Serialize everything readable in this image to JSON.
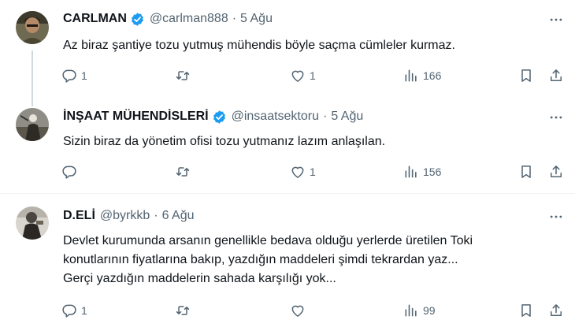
{
  "tweets": [
    {
      "name": "CARLMAN",
      "handle": "@carlman888",
      "separator": "·",
      "date": "5 Ağu",
      "text": "Az biraz şantiye tozu yutmuş mühendis böyle saçma cümleler kurmaz.",
      "replies": "1",
      "retweets": "",
      "likes": "1",
      "views": "166"
    },
    {
      "name": "İNŞAAT MÜHENDİSLERİ",
      "handle": "@insaatsektoru",
      "separator": "·",
      "date": "5 Ağu",
      "text": "Sizin biraz da yönetim ofisi tozu yutmanız lazım anlaşılan.",
      "replies": "",
      "retweets": "",
      "likes": "1",
      "views": "156"
    },
    {
      "name": "D.ELİ",
      "handle": "@byrkkb",
      "separator": "·",
      "date": "6 Ağu",
      "text_lines": [
        "Devlet kurumunda arsanın genellikle bedava olduğu yerlerde üretilen Toki",
        "konutlarının fiyatlarına bakıp, yazdığın maddeleri şimdi tekrardan yaz...",
        "Gerçi yazdığın maddelerin sahada karşılığı yok..."
      ],
      "replies": "1",
      "retweets": "",
      "likes": "",
      "views": "99"
    }
  ],
  "icons": {
    "verified": "verified-badge-icon",
    "more": "more-dots-icon",
    "reply": "reply-icon",
    "retweet": "retweet-icon",
    "like": "heart-icon",
    "views": "views-bar-chart-icon",
    "bookmark": "bookmark-icon",
    "share": "share-icon"
  },
  "colors": {
    "text": "#0f1419",
    "secondary": "#536471",
    "verified": "#1d9bf0",
    "divider": "#eff3f4",
    "thread_line": "#cfd9de"
  }
}
